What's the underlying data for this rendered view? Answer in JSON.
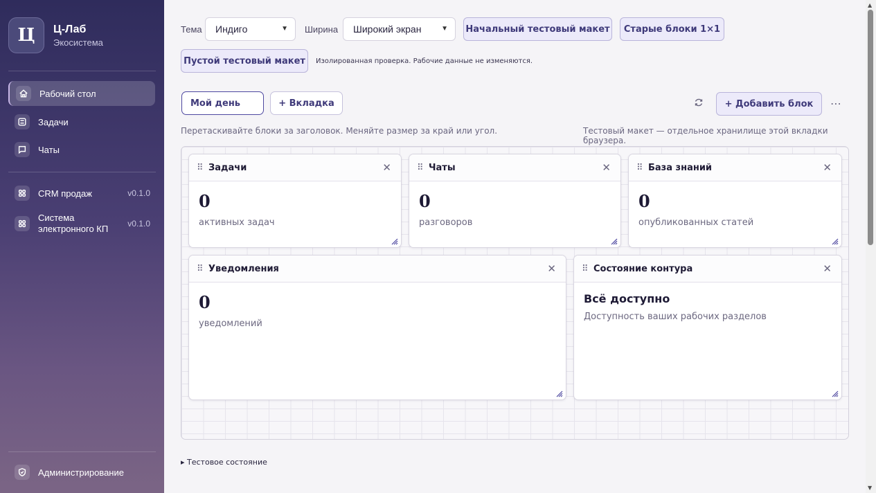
{
  "sidebar": {
    "brand_letter": "Ц",
    "brand_name": "Ц-Лаб",
    "brand_sub": "Экосистема",
    "items": [
      {
        "label": "Рабочий стол",
        "icon": "home-icon"
      },
      {
        "label": "Задачи",
        "icon": "tasks-icon"
      },
      {
        "label": "Чаты",
        "icon": "chat-icon"
      }
    ],
    "apps": [
      {
        "label": "CRM продаж",
        "version": "v0.1.0",
        "icon": "apps-grid-icon"
      },
      {
        "label": "Система электронного КП",
        "version": "v0.1.0",
        "icon": "apps-grid-icon"
      }
    ],
    "admin_label": "Администрирование"
  },
  "toolbar": {
    "theme_label": "Тема",
    "theme_value": "Индиго",
    "width_label": "Ширина",
    "width_value": "Широкий экран",
    "initial_layout": "Начальный тестовый макет",
    "old_blocks": "Старые блоки 1×1",
    "empty_layout": "Пустой тестовый макет",
    "note": "Изолированная проверка. Рабочие данные не изменяются."
  },
  "tabs": {
    "active": "Мой день",
    "add_tab": "+ Вкладка",
    "add_block": "+ Добавить блок",
    "more": "⋯",
    "hint_left": "Перетаскивайте блоки за заголовок. Меняйте размер за край или угол.",
    "hint_right": "Тестовый макет — отдельное хранилище этой вкладки браузера."
  },
  "cards": {
    "tasks": {
      "title": "Задачи",
      "value": "0",
      "sub": "активных задач"
    },
    "chats": {
      "title": "Чаты",
      "value": "0",
      "sub": "разговоров"
    },
    "kb": {
      "title": "База знаний",
      "value": "0",
      "sub": "опубликованных статей"
    },
    "notifications": {
      "title": "Уведомления",
      "value": "0",
      "sub": "уведомлений"
    },
    "status": {
      "title": "Состояние контура",
      "value": "Всё доступно",
      "sub": "Доступность ваших рабочих разделов"
    }
  },
  "details_label": "▸ Тестовое состояние",
  "colors": {
    "accent": "#3f3a7a",
    "sidebar_top": "#2f2c5c",
    "sidebar_bottom": "#7b6585"
  }
}
